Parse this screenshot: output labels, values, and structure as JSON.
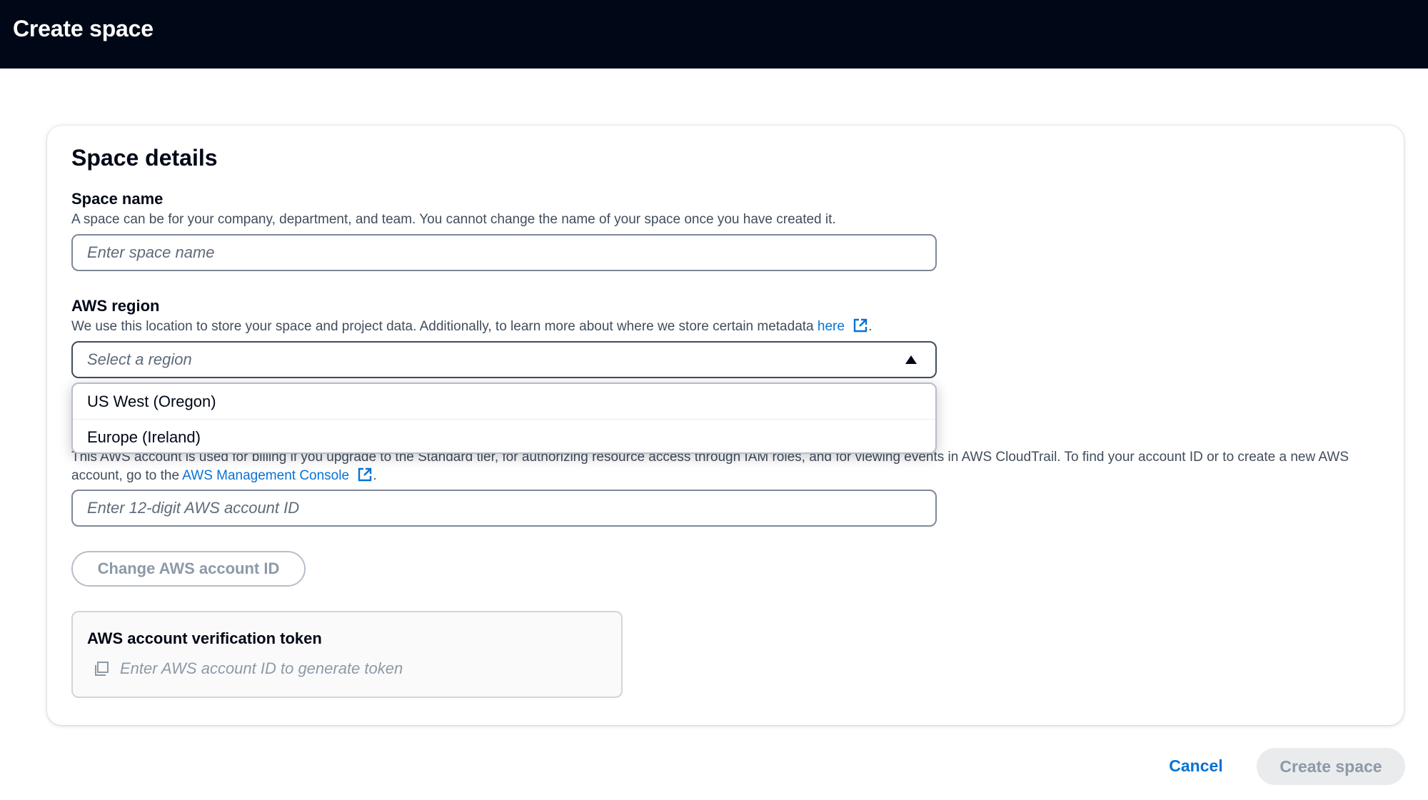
{
  "header": {
    "title": "Create space"
  },
  "section": {
    "title": "Space details"
  },
  "space_name": {
    "label": "Space name",
    "description": "A space can be for your company, department, and team. You cannot change the name of your space once you have created it.",
    "placeholder": "Enter space name",
    "value": ""
  },
  "region": {
    "label": "AWS region",
    "description": "We use this location to store your space and project data. Additionally, to learn more about where we store certain metadata",
    "link_text": "here",
    "trailing": ".",
    "placeholder": "Select a region",
    "options": [
      "US West (Oregon)",
      "Europe (Ireland)"
    ]
  },
  "account": {
    "description_part1": "This AWS account is used for billing if you upgrade to the Standard tier, for authorizing resource access through IAM roles, and for viewing events in AWS CloudTrail. To find your account ID or to create a new AWS account, go to the",
    "link_text": "AWS Management Console",
    "trailing": ".",
    "placeholder": "Enter 12-digit AWS account ID",
    "value": ""
  },
  "change_button": {
    "label": "Change AWS account ID"
  },
  "token": {
    "title": "AWS account verification token",
    "placeholder": "Enter AWS account ID to generate token"
  },
  "footer": {
    "cancel_label": "Cancel",
    "create_label": "Create space"
  },
  "colors": {
    "header_bg": "#000716",
    "link": "#0972d3",
    "disabled": "#8d99a8"
  }
}
